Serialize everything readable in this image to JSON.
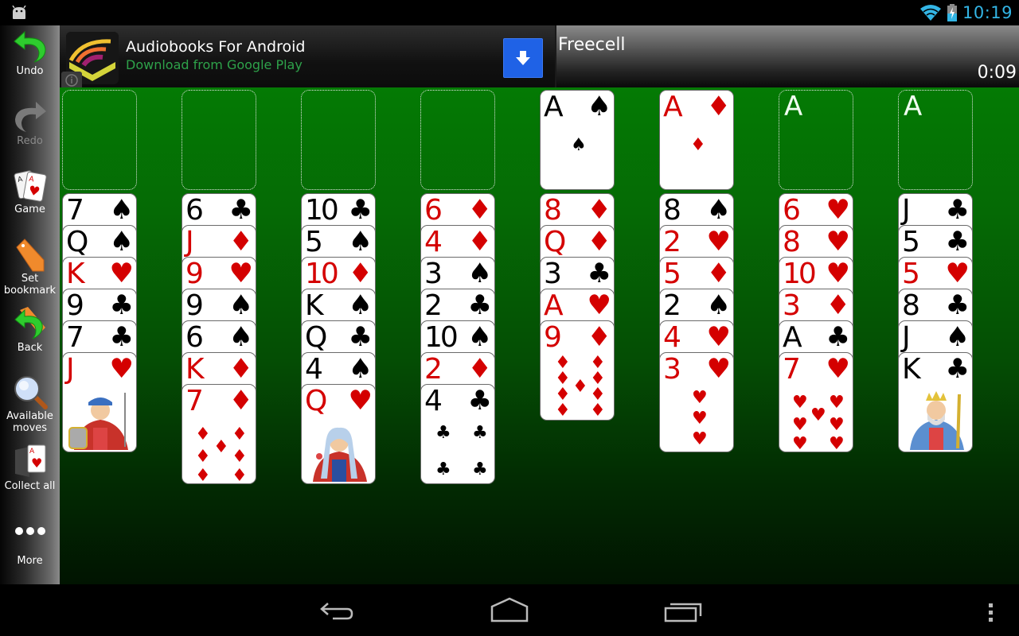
{
  "status_bar": {
    "time": "10:19",
    "icons": [
      "android-debug-icon",
      "wifi-icon",
      "battery-charging-icon"
    ]
  },
  "sidebar": {
    "items": [
      {
        "label": "Undo",
        "icon": "undo-icon",
        "enabled": true
      },
      {
        "label": "Redo",
        "icon": "redo-icon",
        "enabled": false
      },
      {
        "label": "Game",
        "icon": "cards-icon",
        "enabled": true
      },
      {
        "label": "Set bookmark",
        "icon": "bookmark-icon",
        "enabled": true
      },
      {
        "label": "Back",
        "icon": "back-to-bookmark-icon",
        "enabled": true
      },
      {
        "label": "Available moves",
        "icon": "magnifier-icon",
        "enabled": true
      },
      {
        "label": "Collect all",
        "icon": "collect-all-icon",
        "enabled": true
      },
      {
        "label": "More",
        "icon": "more-dots-icon",
        "enabled": true
      }
    ]
  },
  "ad": {
    "title": "Audiobooks For Android",
    "subtitle": "Download from Google Play",
    "info_icon": "info-icon",
    "action_icon": "download-arrow-icon"
  },
  "header": {
    "title": "Freecell",
    "timer": "0:09"
  },
  "colors": {
    "red_suit": "#d40000",
    "black_suit": "#000000",
    "table_green": "#047a04",
    "clock_blue": "#33b5e5",
    "ad_green": "#2ea24a",
    "ad_button": "#1f62e6"
  },
  "free_cells": [
    {
      "card": null
    },
    {
      "card": null
    },
    {
      "card": null
    },
    {
      "card": null
    }
  ],
  "foundations": [
    {
      "top_card": {
        "rank": "A",
        "suit": "spades"
      },
      "placeholder": "A"
    },
    {
      "top_card": {
        "rank": "A",
        "suit": "diamonds"
      },
      "placeholder": "A"
    },
    {
      "top_card": null,
      "placeholder": "A"
    },
    {
      "top_card": null,
      "placeholder": "A"
    }
  ],
  "tableau": [
    [
      {
        "rank": "7",
        "suit": "spades"
      },
      {
        "rank": "Q",
        "suit": "spades"
      },
      {
        "rank": "K",
        "suit": "hearts"
      },
      {
        "rank": "9",
        "suit": "clubs"
      },
      {
        "rank": "7",
        "suit": "clubs"
      },
      {
        "rank": "J",
        "suit": "hearts"
      }
    ],
    [
      {
        "rank": "6",
        "suit": "clubs"
      },
      {
        "rank": "J",
        "suit": "diamonds"
      },
      {
        "rank": "9",
        "suit": "hearts"
      },
      {
        "rank": "9",
        "suit": "spades"
      },
      {
        "rank": "6",
        "suit": "spades"
      },
      {
        "rank": "K",
        "suit": "diamonds"
      },
      {
        "rank": "7",
        "suit": "diamonds"
      }
    ],
    [
      {
        "rank": "10",
        "suit": "clubs"
      },
      {
        "rank": "5",
        "suit": "spades"
      },
      {
        "rank": "10",
        "suit": "diamonds"
      },
      {
        "rank": "K",
        "suit": "spades"
      },
      {
        "rank": "Q",
        "suit": "clubs"
      },
      {
        "rank": "4",
        "suit": "spades"
      },
      {
        "rank": "Q",
        "suit": "hearts"
      }
    ],
    [
      {
        "rank": "6",
        "suit": "diamonds"
      },
      {
        "rank": "4",
        "suit": "diamonds"
      },
      {
        "rank": "3",
        "suit": "spades"
      },
      {
        "rank": "2",
        "suit": "clubs"
      },
      {
        "rank": "10",
        "suit": "spades"
      },
      {
        "rank": "2",
        "suit": "diamonds"
      },
      {
        "rank": "4",
        "suit": "clubs"
      }
    ],
    [
      {
        "rank": "8",
        "suit": "diamonds"
      },
      {
        "rank": "Q",
        "suit": "diamonds"
      },
      {
        "rank": "3",
        "suit": "clubs"
      },
      {
        "rank": "A",
        "suit": "hearts"
      },
      {
        "rank": "9",
        "suit": "diamonds"
      }
    ],
    [
      {
        "rank": "8",
        "suit": "spades"
      },
      {
        "rank": "2",
        "suit": "hearts"
      },
      {
        "rank": "5",
        "suit": "diamonds"
      },
      {
        "rank": "2",
        "suit": "spades"
      },
      {
        "rank": "4",
        "suit": "hearts"
      },
      {
        "rank": "3",
        "suit": "hearts"
      }
    ],
    [
      {
        "rank": "6",
        "suit": "hearts"
      },
      {
        "rank": "8",
        "suit": "hearts"
      },
      {
        "rank": "10",
        "suit": "hearts"
      },
      {
        "rank": "3",
        "suit": "diamonds"
      },
      {
        "rank": "A",
        "suit": "clubs"
      },
      {
        "rank": "7",
        "suit": "hearts"
      }
    ],
    [
      {
        "rank": "J",
        "suit": "clubs"
      },
      {
        "rank": "5",
        "suit": "clubs"
      },
      {
        "rank": "5",
        "suit": "hearts"
      },
      {
        "rank": "8",
        "suit": "clubs"
      },
      {
        "rank": "J",
        "suit": "spades"
      },
      {
        "rank": "K",
        "suit": "clubs"
      }
    ]
  ],
  "nav_bar": {
    "buttons": [
      "back-icon",
      "home-icon",
      "recent-apps-icon",
      "overflow-menu-icon"
    ]
  }
}
